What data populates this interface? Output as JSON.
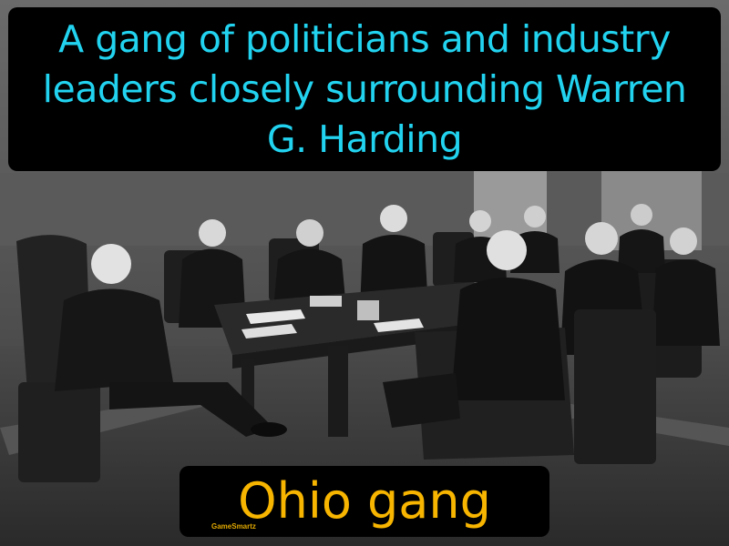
{
  "card": {
    "definition": "A gang of politicians and industry leaders closely surrounding Warren G. Harding",
    "term": "Ohio gang",
    "brand": "GameSmartz"
  },
  "colors": {
    "definition_text": "#22d3f0",
    "term_text": "#f7b500",
    "box_background": "#000000"
  }
}
